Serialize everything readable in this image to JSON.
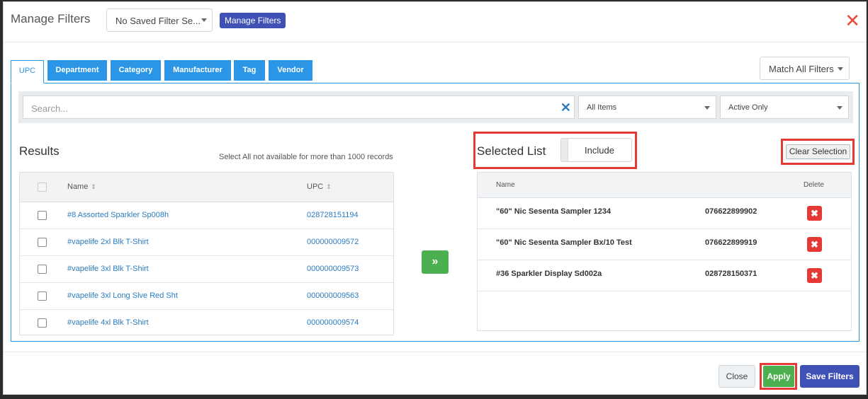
{
  "header": {
    "title": "Manage Filters",
    "saved_filter_select": "No Saved Filter Se...",
    "manage_filters_button": "Manage Filters",
    "close_glyph": "✕"
  },
  "match_select": "Match All Filters",
  "tabs": [
    {
      "label": "UPC",
      "active": true
    },
    {
      "label": "Department",
      "active": false
    },
    {
      "label": "Category",
      "active": false
    },
    {
      "label": "Manufacturer",
      "active": false
    },
    {
      "label": "Tag",
      "active": false
    },
    {
      "label": "Vendor",
      "active": false
    }
  ],
  "search": {
    "placeholder": "Search...",
    "clear_glyph": "✕",
    "items_select": "All Items",
    "status_select": "Active Only"
  },
  "results": {
    "title": "Results",
    "note": "Select All not available for more than 1000 records",
    "columns": {
      "name": "Name",
      "upc": "UPC"
    },
    "sort_glyph": "⇕",
    "rows": [
      {
        "name": "#8 Assorted Sparkler Sp008h",
        "upc": "028728151194"
      },
      {
        "name": "#vapelife 2xl Blk T-Shirt",
        "upc": "000000009572"
      },
      {
        "name": "#vapelife 3xl Blk T-Shirt",
        "upc": "000000009573"
      },
      {
        "name": "#vapelife 3xl Long Slve Red Sht",
        "upc": "000000009563"
      },
      {
        "name": "#vapelife 4xl Blk T-Shirt",
        "upc": "000000009574"
      }
    ]
  },
  "move_button_glyph": "»",
  "selected": {
    "title": "Selected List",
    "toggle_label": "Include",
    "clear_button": "Clear Selection",
    "columns": {
      "name": "Name",
      "delete": "Delete"
    },
    "delete_glyph": "✖",
    "rows": [
      {
        "name": "\"60\" Nic Sesenta Sampler 1234",
        "upc": "076622899902"
      },
      {
        "name": "\"60\" Nic Sesenta Sampler Bx/10 Test",
        "upc": "076622899919"
      },
      {
        "name": "#36 Sparkler Display Sd002a",
        "upc": "028728150371"
      }
    ]
  },
  "footer": {
    "close_button": "Close",
    "apply_button": "Apply",
    "save_button": "Save Filters"
  },
  "colors": {
    "primary_blue": "#2b96e6",
    "indigo": "#3f51b5",
    "green": "#4caf50",
    "red": "#e53935",
    "highlight": "#e53935"
  }
}
